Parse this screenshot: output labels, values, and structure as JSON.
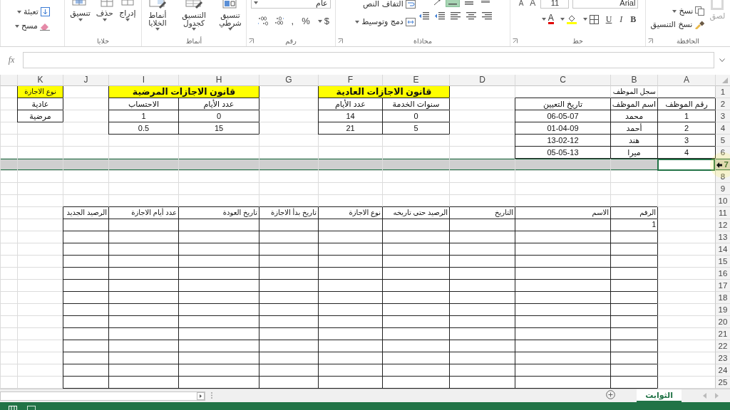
{
  "ribbon": {
    "groups": [
      {
        "kind": "clipboard",
        "label": "الحافظة",
        "items": [
          {
            "label": "لصق",
            "disabled": true
          },
          {
            "label": "نسخ",
            "disabled": false
          },
          {
            "label": "نسخ التنسيق",
            "disabled": false
          }
        ]
      },
      {
        "kind": "font",
        "label": "خط",
        "font_name": "Arial",
        "font_size": "11",
        "size_buttons": [
          "A",
          "A"
        ],
        "style_buttons": [
          "B",
          "I",
          "U"
        ],
        "font_color": "A"
      },
      {
        "kind": "alignment",
        "label": "محاذاة",
        "vertical_align": [
          {
            "selected": false
          },
          {
            "selected": false
          },
          {
            "selected": true
          }
        ],
        "wrap_text": "التفاف النص",
        "merge": "دمج وتوسيط"
      },
      {
        "kind": "number",
        "label": "رقم",
        "format": "عام",
        "buttons": [
          "$",
          "%",
          ","
        ]
      },
      {
        "kind": "styles",
        "label": "أنماط",
        "buttons": [
          "تنسيق شرطي",
          "التنسيق كجدول",
          "أنماط الخلايا"
        ]
      },
      {
        "kind": "cells",
        "label": "خلايا",
        "buttons": [
          "إدراج",
          "حذف",
          "تنسيق"
        ]
      },
      {
        "kind": "editing",
        "buttons": [
          "تعبئة",
          "مسح"
        ]
      }
    ]
  },
  "formula_bar": {
    "function_label": "fx"
  },
  "sheet": {
    "columns": [
      "A",
      "B",
      "C",
      "D",
      "E",
      "F",
      "G",
      "H",
      "I",
      "J",
      "K"
    ],
    "rows": [
      {
        "number": "1",
        "selected": false,
        "cells": {
          "B": {
            "text": "سجل الموظف",
            "kind": "right"
          },
          "E": {
            "text": "قانون الاجازات العادية",
            "kind": "title",
            "merged": true
          },
          "H": {
            "text": "قانون الاجازات المرضية",
            "kind": "title",
            "merged": true
          },
          "K": {
            "text": "نوع الاجازة",
            "kind": "tag",
            "merged": false
          }
        }
      },
      {
        "number": "2",
        "selected": false,
        "cells": {
          "A": {
            "text": "رقم الموظف",
            "kind": "center"
          },
          "B": {
            "text": "اسم الموظف",
            "kind": "center"
          },
          "C": {
            "text": "تاريخ التعيين",
            "kind": "center"
          },
          "E": {
            "text": "سنوات الخدمة",
            "kind": "center"
          },
          "F": {
            "text": "عدد الأيام",
            "kind": "center"
          },
          "H": {
            "text": "عدد الأيام",
            "kind": "center"
          },
          "I": {
            "text": "الاحتساب",
            "kind": "center"
          },
          "K": {
            "text": "عادية",
            "kind": "center"
          }
        }
      },
      {
        "number": "3",
        "selected": false,
        "cells": {
          "A": {
            "text": "1",
            "kind": "center"
          },
          "B": {
            "text": "محمد",
            "kind": "center"
          },
          "C": {
            "text": "06-05-07",
            "kind": "center"
          },
          "E": {
            "text": "0",
            "kind": "center"
          },
          "F": {
            "text": "14",
            "kind": "center"
          },
          "H": {
            "text": "0",
            "kind": "center"
          },
          "I": {
            "text": "1",
            "kind": "center"
          },
          "K": {
            "text": "مرضية",
            "kind": "center"
          }
        }
      },
      {
        "number": "4",
        "selected": false,
        "cells": {
          "A": {
            "text": "2",
            "kind": "center"
          },
          "B": {
            "text": "أحمد",
            "kind": "center"
          },
          "C": {
            "text": "01-04-09",
            "kind": "center"
          },
          "E": {
            "text": "5",
            "kind": "center"
          },
          "F": {
            "text": "21",
            "kind": "center"
          },
          "H": {
            "text": "15",
            "kind": "center"
          },
          "I": {
            "text": "0.5",
            "kind": "center"
          }
        }
      },
      {
        "number": "5",
        "selected": false,
        "cells": {
          "A": {
            "text": "3",
            "kind": "center"
          },
          "B": {
            "text": "هند",
            "kind": "center"
          },
          "C": {
            "text": "13-02-12",
            "kind": "center"
          }
        }
      },
      {
        "number": "6",
        "selected": false,
        "cells": {
          "A": {
            "text": "4",
            "kind": "center"
          },
          "B": {
            "text": "ميرا",
            "kind": "center"
          },
          "C": {
            "text": "05-05-13",
            "kind": "center"
          }
        }
      },
      {
        "number": "7",
        "selected": true
      },
      {
        "number": "8",
        "selected": false
      },
      {
        "number": "9",
        "selected": false
      },
      {
        "number": "10",
        "selected": false
      },
      {
        "number": "11",
        "selected": false,
        "cells": {
          "B": {
            "text": "الرقم",
            "kind": "right"
          },
          "C": {
            "text": "الاسم",
            "kind": "right"
          },
          "D": {
            "text": "التاريخ",
            "kind": "right"
          },
          "E": {
            "text": "الرصيد حتى تاريخه",
            "kind": "right"
          },
          "F": {
            "text": "نوع الاجازة",
            "kind": "right"
          },
          "G": {
            "text": "تاريخ بدأ الاجازة",
            "kind": "right"
          },
          "H": {
            "text": "تاريخ العودة",
            "kind": "right"
          },
          "I": {
            "text": "عدد أيام الاجازة",
            "kind": "right"
          },
          "J": {
            "text": "الرصيد الجديد",
            "kind": "right"
          }
        }
      },
      {
        "number": "12",
        "selected": false,
        "cells": {
          "B": {
            "text": "1",
            "kind": "right"
          }
        }
      },
      {
        "number": "13",
        "selected": false
      },
      {
        "number": "14",
        "selected": false
      },
      {
        "number": "15",
        "selected": false
      },
      {
        "number": "16",
        "selected": false
      },
      {
        "number": "17",
        "selected": false
      },
      {
        "number": "18",
        "selected": false
      },
      {
        "number": "19",
        "selected": false
      },
      {
        "number": "20",
        "selected": false
      },
      {
        "number": "21",
        "selected": false
      },
      {
        "number": "22",
        "selected": false
      },
      {
        "number": "23",
        "selected": false
      },
      {
        "number": "24",
        "selected": false
      },
      {
        "number": "25",
        "selected": false
      }
    ]
  },
  "sheet_tabs": [
    {
      "label": "الثوابت",
      "selected": true
    }
  ]
}
